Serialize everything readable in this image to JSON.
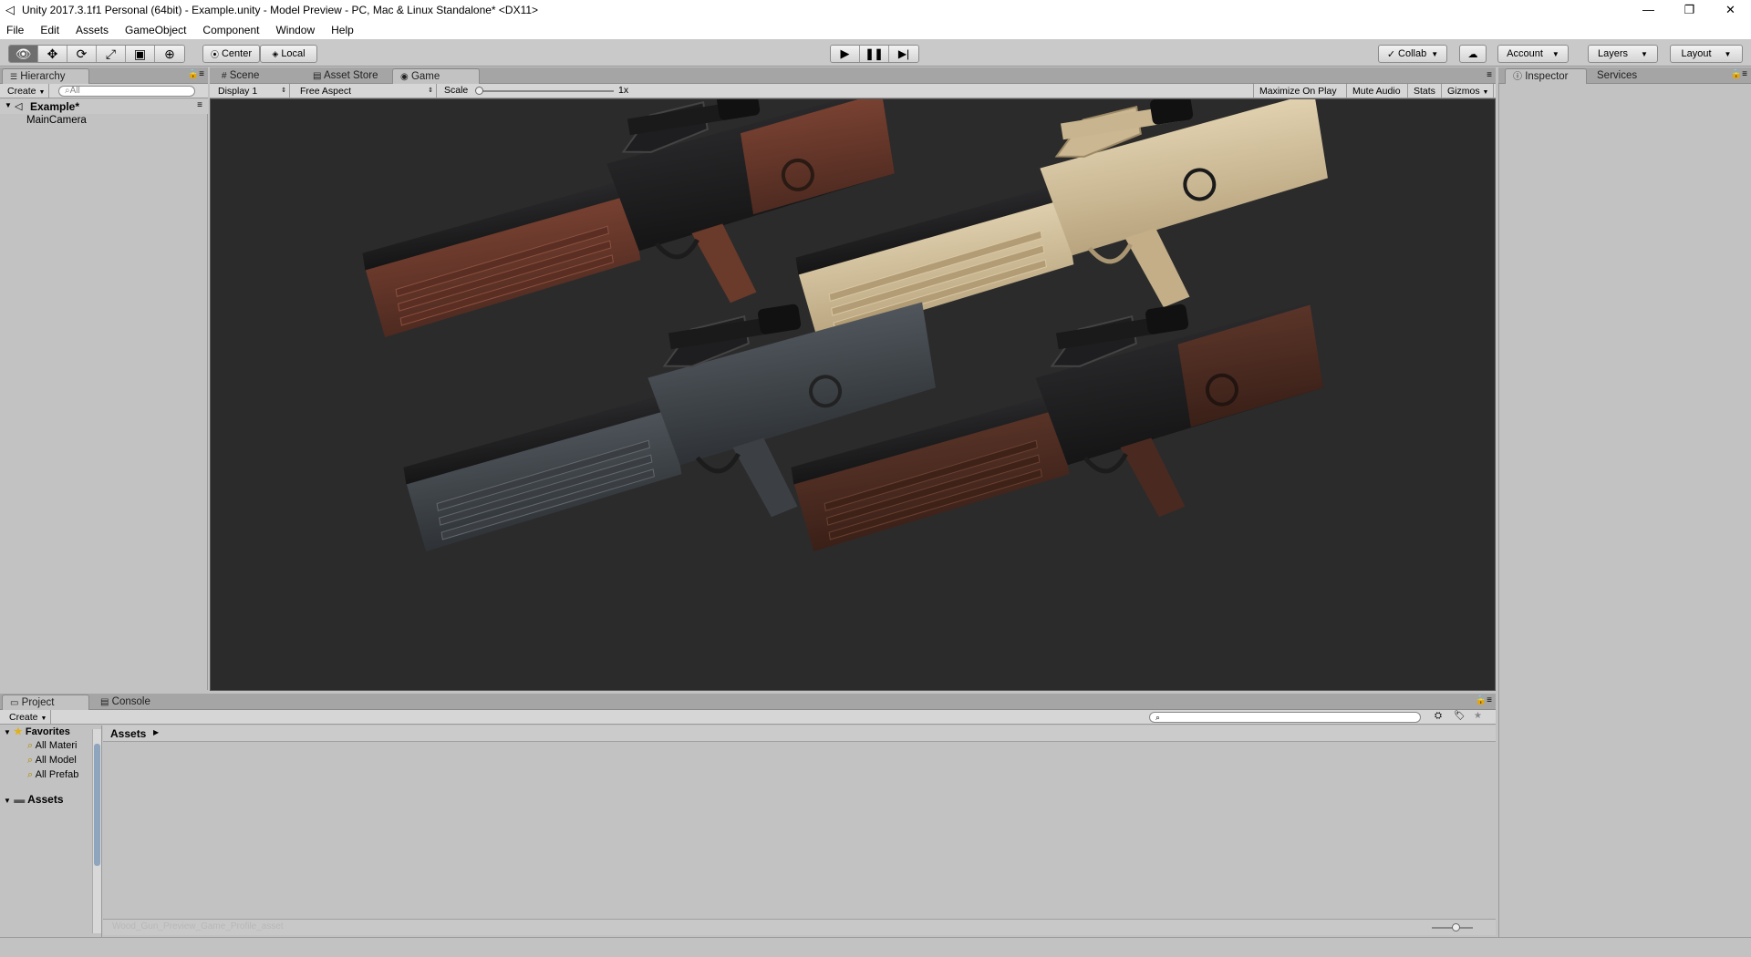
{
  "window": {
    "title": "Unity 2017.3.1f1 Personal (64bit) - Example.unity - Model Preview - PC, Mac & Linux Standalone* <DX11>",
    "app_icon": "unity-icon",
    "minimize": "—",
    "restore": "❐",
    "close": "✕"
  },
  "menu": [
    "File",
    "Edit",
    "Assets",
    "GameObject",
    "Component",
    "Window",
    "Help"
  ],
  "toolbar": {
    "tools": [
      "view-tool-icon",
      "move-tool-icon",
      "rotate-tool-icon",
      "scale-tool-icon",
      "rect-tool-icon",
      "transform-tool-icon"
    ],
    "pivot": "Center",
    "space": "Local",
    "collab": "Collab",
    "account": "Account",
    "layers": "Layers",
    "layout": "Layout"
  },
  "hierarchy": {
    "tab": "Hierarchy",
    "create": "Create",
    "search_placeholder": "All",
    "scene": "Example*",
    "items": [
      "MainCamera"
    ]
  },
  "center_tabs": {
    "scene": "Scene",
    "asset_store": "Asset Store",
    "game": "Game"
  },
  "game_bar": {
    "display": "Display 1",
    "aspect": "Free Aspect",
    "scale_label": "Scale",
    "scale_value": "1x",
    "maximize": "Maximize On Play",
    "mute": "Mute Audio",
    "stats": "Stats",
    "gizmos": "Gizmos"
  },
  "inspector": {
    "tab": "Inspector",
    "services": "Services"
  },
  "project": {
    "tab": "Project",
    "console": "Console",
    "create": "Create",
    "favorites": "Favorites",
    "fav_items": [
      "All Materi",
      "All Model",
      "All Prefab"
    ],
    "assets_root": "Assets",
    "breadcrumb": "Assets",
    "footer_path": "Wood_Gun_Preview_Game_Profile_asset"
  },
  "colors": {
    "editor_bg": "#c2c2c2",
    "game_bg": "#2b2b2b",
    "wood": "#6a3a2a",
    "tan": "#cdbb98",
    "gunmetal": "#3e4246"
  }
}
